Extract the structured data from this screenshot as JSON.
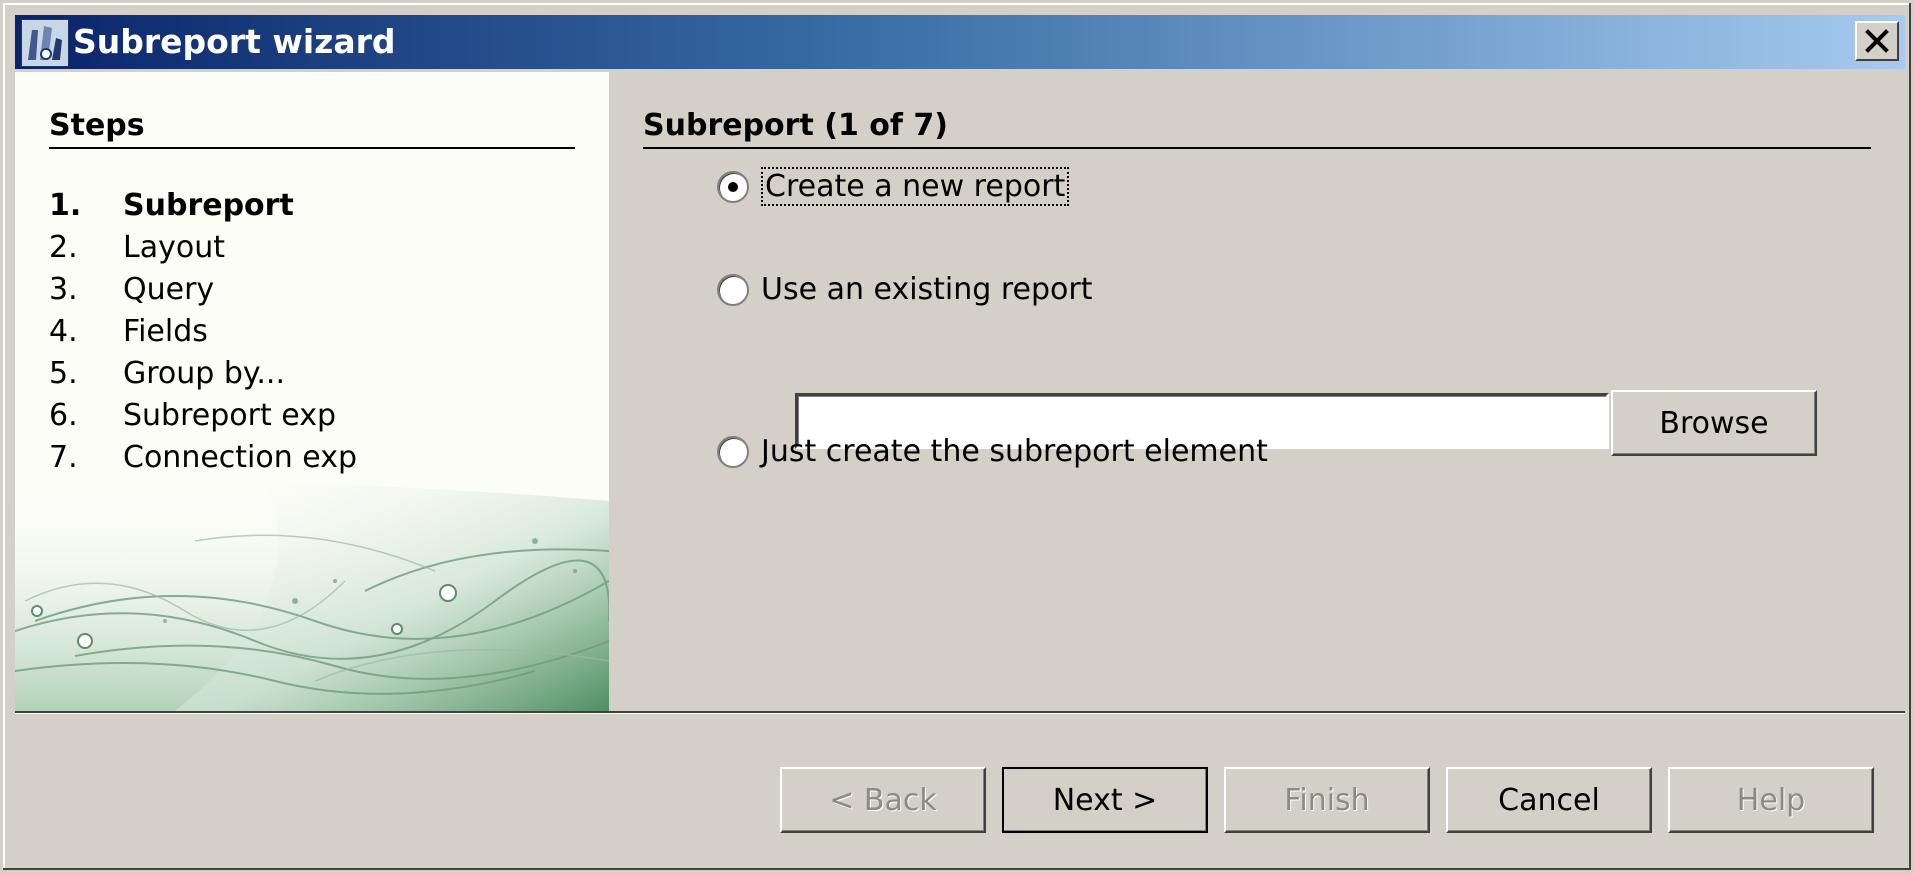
{
  "window": {
    "title": "Subreport wizard"
  },
  "steps": {
    "heading": "Steps",
    "items": [
      {
        "number": "1.",
        "label": "Subreport",
        "active": true
      },
      {
        "number": "2.",
        "label": "Layout"
      },
      {
        "number": "3.",
        "label": "Query"
      },
      {
        "number": "4.",
        "label": "Fields"
      },
      {
        "number": "5.",
        "label": "Group by..."
      },
      {
        "number": "6.",
        "label": "Subreport exp"
      },
      {
        "number": "7.",
        "label": "Connection exp"
      }
    ]
  },
  "main": {
    "heading": "Subreport (1 of 7)",
    "options": {
      "create_new": {
        "label": "Create a new report",
        "selected": true
      },
      "use_existing": {
        "label": "Use an existing report",
        "selected": false
      },
      "just_element": {
        "label": "Just create the subreport element",
        "selected": false
      }
    },
    "report_path": {
      "value": "",
      "placeholder": ""
    },
    "browse_label": "Browse"
  },
  "footer": {
    "back_label": "< Back",
    "next_label": "Next >",
    "finish_label": "Finish",
    "cancel_label": "Cancel",
    "help_label": "Help"
  },
  "colors": {
    "titlebar_start": "#0a246a",
    "titlebar_end": "#a6caf0",
    "dialog_face": "#d4d0c8",
    "steps_panel": "#fdfdf8",
    "decor_green": "#2f7a4a"
  },
  "icons": {
    "app": "wizard-app-icon",
    "close": "close-icon",
    "decoration": "wave-decoration"
  }
}
